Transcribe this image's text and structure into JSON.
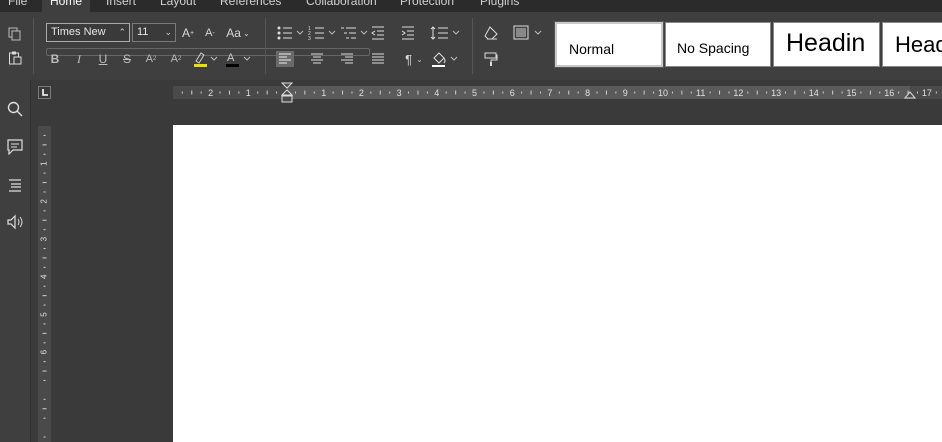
{
  "menu": {
    "items": [
      {
        "label": "File"
      },
      {
        "label": "Home"
      },
      {
        "label": "Insert"
      },
      {
        "label": "Layout"
      },
      {
        "label": "References"
      },
      {
        "label": "Collaboration"
      },
      {
        "label": "Protection"
      },
      {
        "label": "Plugins"
      }
    ]
  },
  "toolbar": {
    "font_name": "Times New",
    "font_size": "11",
    "change_case_label": "Aa",
    "highlight_color": "#e8e000",
    "font_color": "#000000"
  },
  "styles": [
    {
      "label": "Normal"
    },
    {
      "label": "No Spacing"
    },
    {
      "label": "Headin"
    },
    {
      "label": "Head"
    }
  ],
  "ruler": {
    "h_labels": [
      "2",
      "1",
      "",
      "1",
      "2",
      "3",
      "4",
      "5",
      "6",
      "7",
      "8",
      "9",
      "10",
      "11",
      "12",
      "13",
      "14",
      "15",
      "16",
      "17"
    ],
    "v_labels": [
      "1",
      "2",
      "3",
      "4",
      "5",
      "6"
    ]
  },
  "sidebar": {
    "icons": [
      "search-icon",
      "comment-icon",
      "navigation-icon",
      "speaker-icon"
    ]
  }
}
